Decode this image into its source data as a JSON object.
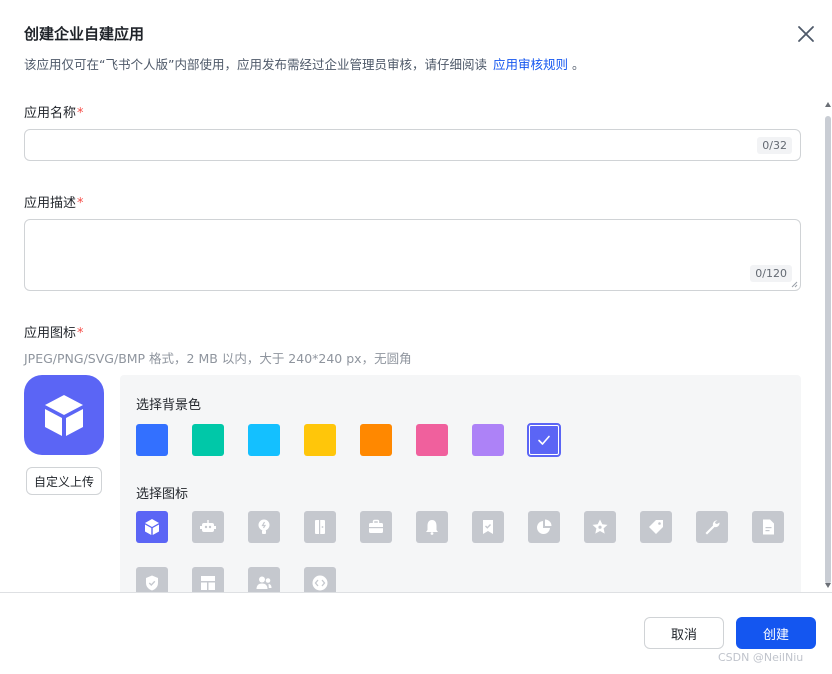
{
  "dialog": {
    "title": "创建企业自建应用",
    "subtitle": "该应用仅可在“飞书个人版”内部使用，应用发布需经过企业管理员审核，请仔细阅读",
    "subtitle_link": "应用审核规则",
    "subtitle_end": "。"
  },
  "form": {
    "name_label": "应用名称",
    "name_value": "",
    "name_counter": "0/32",
    "desc_label": "应用描述",
    "desc_value": "",
    "desc_counter": "0/120",
    "icon_label": "应用图标",
    "icon_hint": "JPEG/PNG/SVG/BMP 格式，2 MB 以内，大于 240*240 px，无圆角",
    "required_mark": "*",
    "upload_label": "自定义上传"
  },
  "picker": {
    "bg_label": "选择背景色",
    "icon_label": "选择图标",
    "colors": [
      "#3370ff",
      "#00c8a8",
      "#14c0ff",
      "#ffc60a",
      "#ff8800",
      "#f0609d",
      "#ad82f7",
      "#5b65f5"
    ],
    "selected_color_index": 7,
    "icons": [
      "cube-icon",
      "robot-icon",
      "lightbulb-icon",
      "door-icon",
      "briefcase-icon",
      "bell-icon",
      "bookmark-check-icon",
      "pie-chart-icon",
      "star-icon",
      "tag-icon",
      "wrench-icon",
      "document-icon",
      "shield-check-icon",
      "layout-icon",
      "users-icon",
      "code-icon"
    ],
    "selected_icon_index": 0
  },
  "footer": {
    "cancel_label": "取消",
    "create_label": "创建",
    "watermark": "CSDN @NeilNiu"
  }
}
